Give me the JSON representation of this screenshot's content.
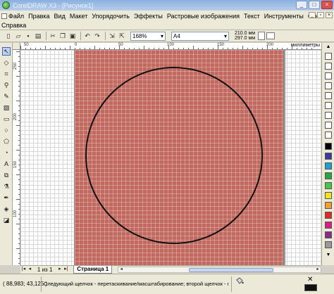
{
  "window": {
    "title": "CorelDRAW X3 - [Рисунок1]",
    "buttons": [
      "_",
      "□",
      "×"
    ]
  },
  "menu": {
    "items": [
      "Файл",
      "Правка",
      "Вид",
      "Макет",
      "Упорядочить",
      "Эффекты",
      "Растровые изображения",
      "Текст",
      "Инструменты",
      "Окно"
    ],
    "row2": [
      "Справка"
    ]
  },
  "toolbar": {
    "zoom_value": "168%",
    "paper_value": "A4",
    "width_value": "210.0 мм",
    "height_value": "297.0 мм"
  },
  "ruler": {
    "h_labels": [
      "50",
      "0",
      "50",
      "100",
      "150",
      "200"
    ],
    "v_labels": [
      "250",
      "200",
      "150",
      "100"
    ],
    "unit": "миллиметры"
  },
  "pagebar": {
    "page_count": "1 из 1",
    "page_tab": "Страница 1"
  },
  "status": {
    "coords": "( 88,983; 43,125 )",
    "hint": "Следующий щелчок - перетаскивание/масштабирование; второй щелчок - поворот/..."
  },
  "colors": {
    "page_fill": "#c26a60",
    "palette": [
      "#ffffff",
      "#000000",
      "#3b3b9c",
      "#1aa0d8",
      "#29a347",
      "#4ac44a",
      "#f2e31c",
      "#f0a030",
      "#e02a2a",
      "#d81e8c",
      "#8a2a8a",
      "#9a9a9a"
    ]
  }
}
